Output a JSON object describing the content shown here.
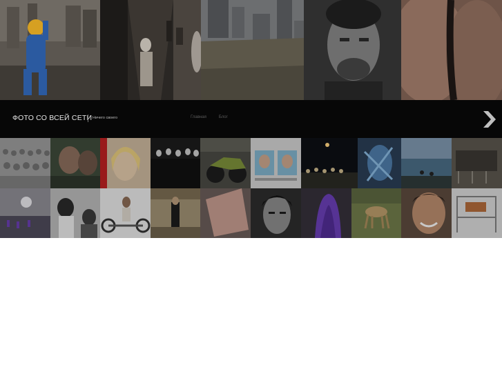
{
  "header": {
    "site_title": "ФОТО СО ВСЕЙ СЕТИ",
    "tagline": "Ничего своего",
    "nav": [
      {
        "label": "Главная"
      },
      {
        "label": "Блог"
      }
    ]
  },
  "next_icon": "chevron-right-icon",
  "colors": {
    "header_bg": "#070707",
    "title_text": "#e6e6e6",
    "nav_text": "#5c5c5c",
    "arrow": "#bfbfbf"
  }
}
